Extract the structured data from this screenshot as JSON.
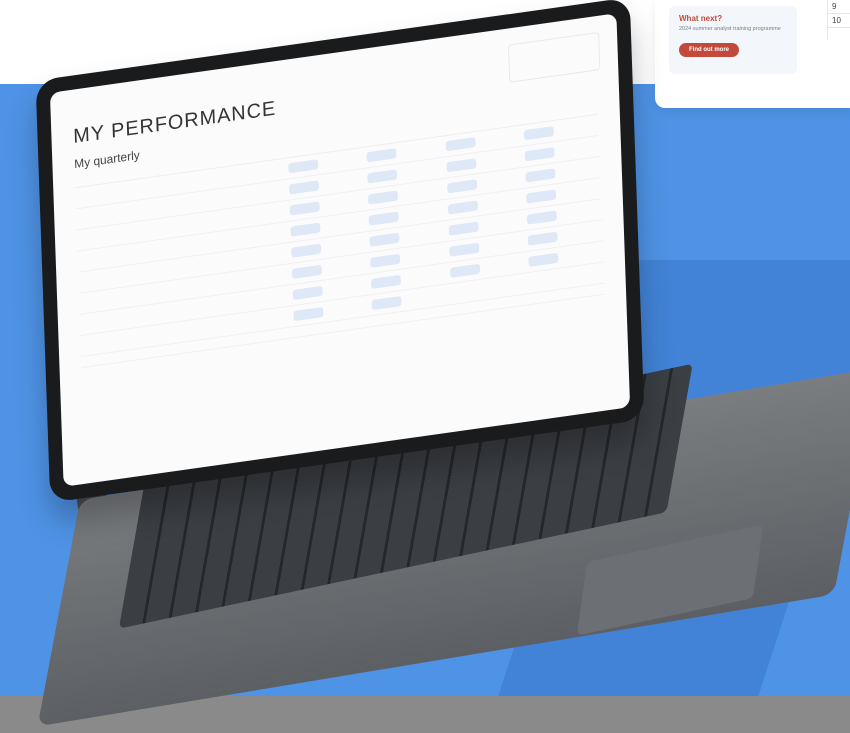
{
  "card": {
    "title": "What next?",
    "text": "2024 summer analyst training programme",
    "button": "Find out more",
    "side_numbers": [
      "9",
      "10"
    ]
  },
  "tablet": {
    "title": "MY PERFORMANCE",
    "subtitle": "My quarterly"
  },
  "colors": {
    "accent": "#c24a3c",
    "background_blue": "#4f93e6",
    "pill_bg": "#dfe8f7"
  }
}
